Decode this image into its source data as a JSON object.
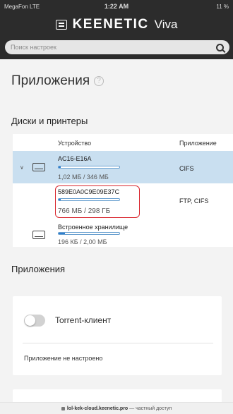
{
  "status_bar": {
    "carrier": "MegaFon LTE",
    "time": "1:22 AM",
    "battery": "11 %"
  },
  "header": {
    "brand": "KEENETIC",
    "model": "Viva"
  },
  "search": {
    "placeholder": "Поиск настроек"
  },
  "page": {
    "title": "Приложения"
  },
  "disks": {
    "title": "Диски и принтеры",
    "columns": [
      "Устройство",
      "Приложение"
    ],
    "rows": [
      {
        "name": "AC16-E16A",
        "size": "1,02 МБ / 346 МБ",
        "fill": 0.02,
        "apps": "CIFS",
        "selected": true
      },
      {
        "name": "589E0A0C9E09E37C",
        "size": "766 МБ / 298 ГБ",
        "fill": 0.01,
        "apps": "FTP, CIFS",
        "selected": false
      },
      {
        "name": "Встроенное хранилище",
        "size": "196 КБ / 2,00 МБ",
        "fill": 0.1,
        "apps": "",
        "selected": false
      }
    ]
  },
  "apps_section": {
    "title": "Приложения",
    "torrent_label": "Torrent-клиент",
    "torrent_enabled": false,
    "note": "Приложение не настроено"
  },
  "url_bar": {
    "host": "lol-kek-cloud.keenetic.pro",
    "suffix": "— частный доступ"
  }
}
